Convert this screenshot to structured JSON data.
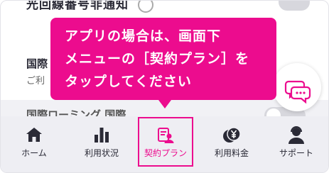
{
  "settings": {
    "top_item_label": "光回線番号非通知",
    "mid_item_title": "国際",
    "mid_item_subtitle": "ご利",
    "low_item_label": "国際ローミング 国際"
  },
  "tooltip": {
    "lines": [
      "アプリの場合は、画面下",
      "メニューの［契約プラン］を",
      "タップしてください"
    ]
  },
  "tabs": [
    {
      "id": "home",
      "label": "ホーム",
      "icon": "home-icon"
    },
    {
      "id": "usage",
      "label": "利用状況",
      "icon": "bar-chart-icon"
    },
    {
      "id": "plan",
      "label": "契約プラン",
      "icon": "contract-icon",
      "active": true
    },
    {
      "id": "fee",
      "label": "利用料金",
      "icon": "yen-coins-icon"
    },
    {
      "id": "support",
      "label": "サポート",
      "icon": "support-person-icon"
    }
  ],
  "colors": {
    "accent": "#ec0c8e",
    "tabbar_bg": "#eeeef3",
    "text": "#2a2a36"
  }
}
